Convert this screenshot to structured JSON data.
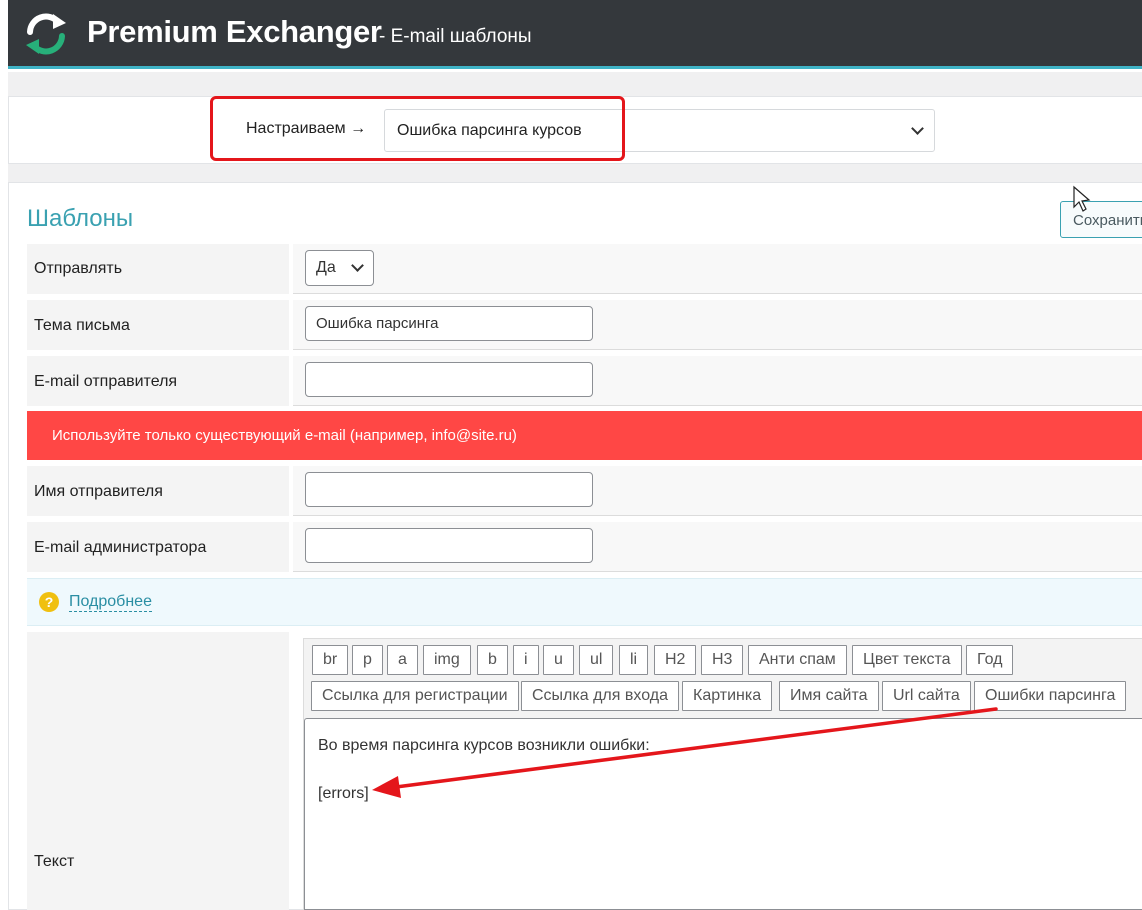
{
  "header": {
    "title": "Premium Exchanger",
    "subtitle": "- E-mail шаблоны",
    "logo_icon": "refresh-arrows-logo",
    "background": "#34383c",
    "accent": "#3fb3c6"
  },
  "chooser": {
    "label": "Настраиваем →",
    "selected": "Ошибка парсинга курсов",
    "highlight_color": "#e4161b"
  },
  "section": {
    "title": "Шаблоны",
    "save_label": "Сохранить"
  },
  "form": {
    "send": {
      "label": "Отправлять",
      "value": "Да"
    },
    "subject": {
      "label": "Тема письма",
      "value": "Ошибка парсинга"
    },
    "sender_email": {
      "label": "E-mail отправителя",
      "value": ""
    },
    "warning": "Используйте только существующий e-mail (например, info@site.ru)",
    "sender_name": {
      "label": "Имя отправителя",
      "value": ""
    },
    "admin_email": {
      "label": "E-mail администратора",
      "value": ""
    },
    "more_link": "Подробнее",
    "text_label": "Текст"
  },
  "editor": {
    "tags_row1": [
      "br",
      "p",
      "a",
      "img",
      "b",
      "i",
      "u",
      "ul",
      "li",
      "H2",
      "H3",
      "Анти спам",
      "Цвет текста",
      "Год"
    ],
    "tags_row2": [
      "Ссылка для регистрации",
      "Ссылка для входа",
      "Картинка",
      "Имя сайта",
      "Url сайта",
      "Ошибки парсинга"
    ],
    "content_line1": "Во время парсинга курсов возникли ошибки:",
    "content_line2": "[errors]"
  },
  "colors": {
    "warning_bg": "#ff4745",
    "link": "#2a8ea3",
    "annotation_arrow": "#e4161b"
  }
}
